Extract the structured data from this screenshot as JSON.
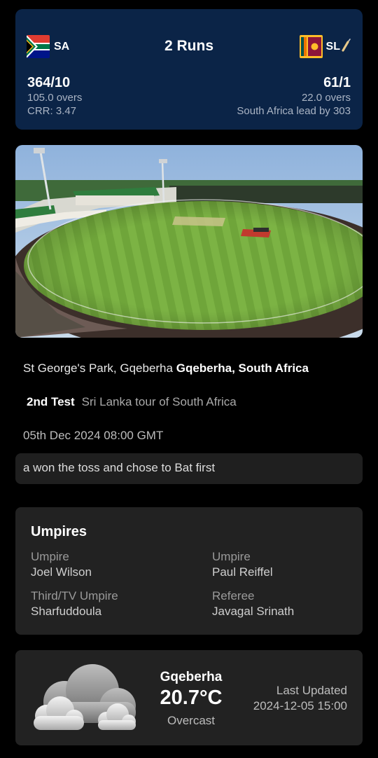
{
  "score": {
    "home": {
      "code": "SA",
      "score": "364/10",
      "overs": "105.0 overs",
      "extra": "CRR: 3.47",
      "flag_icon": "south-africa-flag-icon"
    },
    "away": {
      "code": "SL",
      "score": "61/1",
      "overs": "22.0 overs",
      "extra": "South Africa lead by 303",
      "flag_icon": "sri-lanka-flag-icon",
      "batting_icon": "cricket-bat-icon"
    },
    "status": "2 Runs"
  },
  "venue": {
    "name": "St George's Park, Gqeberha",
    "city_country": "Gqeberha, South Africa"
  },
  "match": {
    "number": "2nd Test",
    "series": "Sri Lanka tour of South Africa",
    "datetime": "05th Dec 2024 08:00 GMT",
    "toss": "a won the toss and chose to Bat first"
  },
  "umpires": {
    "title": "Umpires",
    "items": [
      {
        "label": "Umpire",
        "name": "Joel Wilson"
      },
      {
        "label": "Umpire",
        "name": "Paul Reiffel"
      },
      {
        "label": "Third/TV Umpire",
        "name": "Sharfuddoula"
      },
      {
        "label": "Referee",
        "name": "Javagal Srinath"
      }
    ]
  },
  "weather": {
    "city": "Gqeberha",
    "temperature": "20.7°C",
    "condition": "Overcast",
    "updated_label": "Last Updated",
    "updated_time": "2024-12-05 15:00",
    "icon": "overcast-cloud-icon"
  },
  "colors": {
    "score_card_bg": "#0b2447",
    "card_bg": "#222222",
    "page_bg": "#000000"
  }
}
